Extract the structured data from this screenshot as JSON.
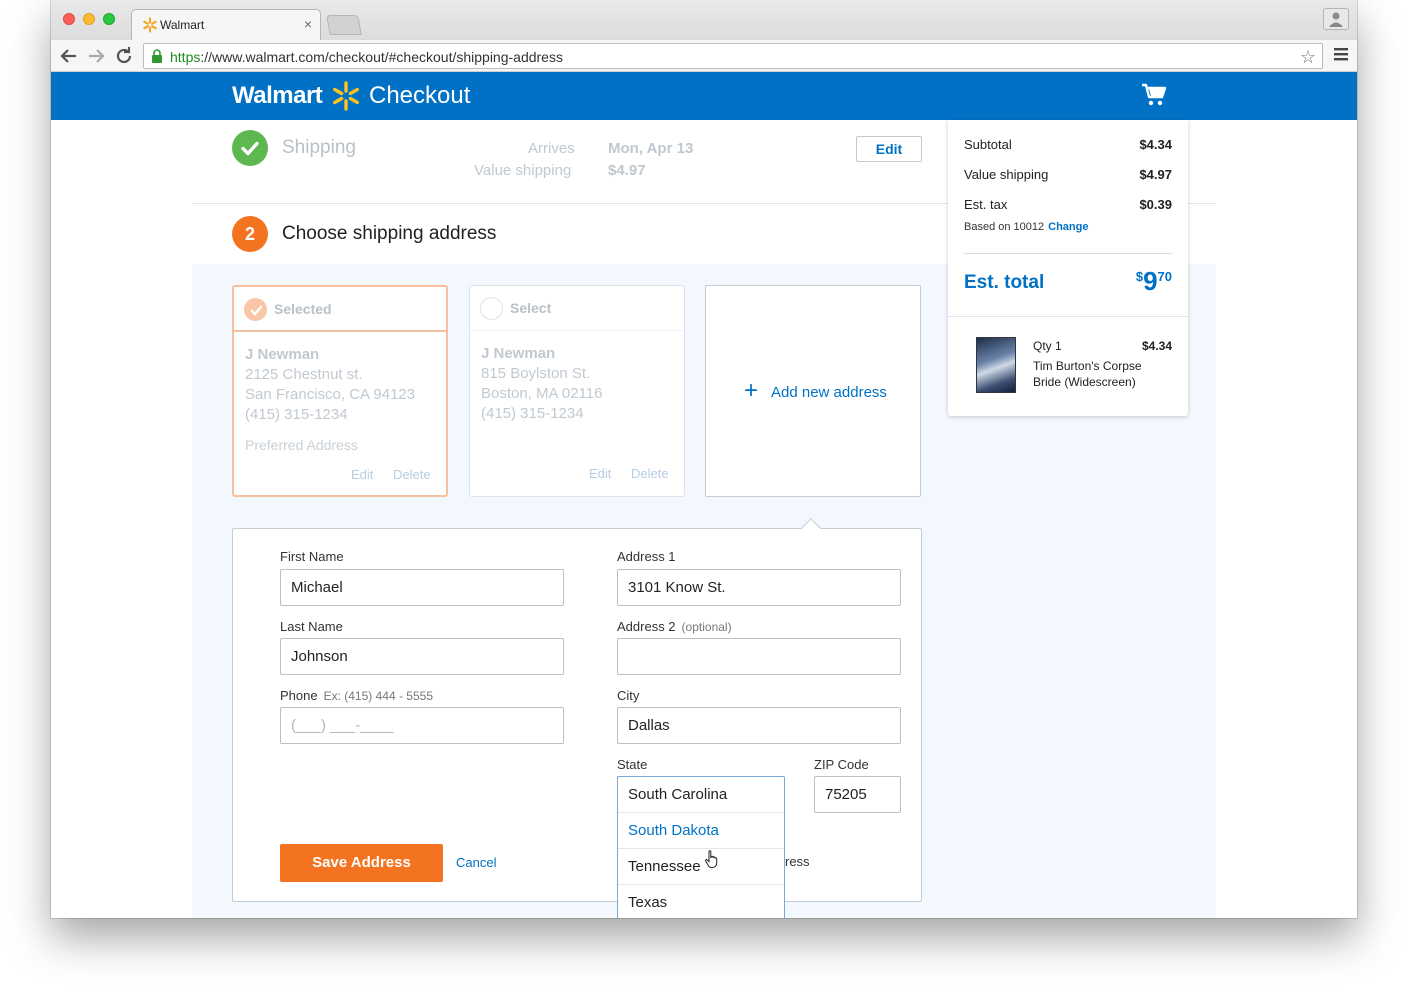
{
  "browser": {
    "tab_title": "Walmart",
    "tab_close": "×",
    "url_scheme": "https",
    "url_rest": "://www.walmart.com/checkout/#checkout/shipping-address",
    "star": "☆"
  },
  "header": {
    "logo_text": "Walmart",
    "title": "Checkout"
  },
  "step1": {
    "title": "Shipping",
    "arrives_label": "Arrives",
    "arrives_value": "Mon, Apr 13",
    "shipping_label": "Value shipping",
    "shipping_value": "$4.97",
    "edit_label": "Edit"
  },
  "step2": {
    "number": "2",
    "title": "Choose shipping address"
  },
  "addresses": [
    {
      "head_label": "Selected",
      "name": "J Newman",
      "line1": "2125 Chestnut st.",
      "line2": "San Francisco, CA 94123",
      "phone": "(415) 315-1234",
      "preferred": "Preferred Address",
      "edit": "Edit",
      "delete": "Delete"
    },
    {
      "head_label": "Select",
      "name": "J Newman",
      "line1": "815 Boylston St.",
      "line2": "Boston, MA 02116",
      "phone": "(415) 315-1234",
      "edit": "Edit",
      "delete": "Delete"
    }
  ],
  "add_address": {
    "plus": "+",
    "label": "Add new address"
  },
  "form": {
    "first_name_label": "First Name",
    "first_name": "Michael",
    "last_name_label": "Last Name",
    "last_name": "Johnson",
    "phone_label": "Phone",
    "phone_hint": "Ex: (415) 444 - 5555",
    "phone_mask": "(___) ___-____",
    "address1_label": "Address 1",
    "address1": "3101 Know St.",
    "address2_label": "Address 2",
    "address2_hint": "(optional)",
    "address2": "",
    "city_label": "City",
    "city": "Dallas",
    "state_label": "State",
    "state_options": [
      "South Carolina",
      "South Dakota",
      "Tennessee",
      "Texas"
    ],
    "zip_label": "ZIP Code",
    "zip": "75205",
    "save_label": "Save Address",
    "cancel_label": "Cancel",
    "trailing_text": "ress"
  },
  "summary": {
    "subtotal_label": "Subtotal",
    "subtotal": "$4.34",
    "shipping_label": "Value shipping",
    "shipping": "$4.97",
    "tax_label": "Est. tax",
    "tax": "$0.39",
    "based_on": "Based on 10012",
    "change": "Change",
    "total_label": "Est. total",
    "total_currency": "$",
    "total_dollars": "9",
    "total_cents": "70",
    "item_qty": "Qty 1",
    "item_price": "$4.34",
    "item_name": "Tim Burton's Corpse Bride (Widescreen)"
  },
  "colors": {
    "brand_blue": "#0071c5",
    "accent_orange": "#f47321",
    "success_green": "#5db84f"
  }
}
